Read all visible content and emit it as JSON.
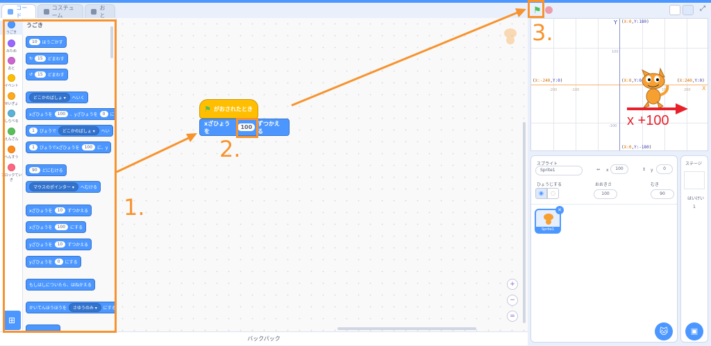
{
  "tabs": [
    {
      "label": "コード"
    },
    {
      "label": "コスチューム"
    },
    {
      "label": "おと"
    }
  ],
  "categories": [
    {
      "label": "うごき",
      "color": "#4c97ff"
    },
    {
      "label": "みため",
      "color": "#9966ff"
    },
    {
      "label": "おと",
      "color": "#cf63cf"
    },
    {
      "label": "イベント",
      "color": "#ffbf00"
    },
    {
      "label": "せいぎょ",
      "color": "#ffab19"
    },
    {
      "label": "しらべる",
      "color": "#5cb1d6"
    },
    {
      "label": "えんざん",
      "color": "#59c059"
    },
    {
      "label": "へんすう",
      "color": "#ff8c1a"
    },
    {
      "label": "ブロックてい",
      "color": "#ff6680"
    }
  ],
  "categories_extra": "ぎ",
  "palette": {
    "title": "うごき",
    "b1": {
      "val": "10",
      "text": "ほうごかす"
    },
    "b2": {
      "val": "15",
      "text": "どまわす"
    },
    "b3": {
      "val": "15",
      "text": "どまわす"
    },
    "b4": {
      "dd": "どこかのばしょ ▾",
      "text": "へいく"
    },
    "b5": {
      "t1": "xざひょうを",
      "v1": "100",
      "t2": "、yざひょうを",
      "v2": "0",
      "t3": "にす"
    },
    "b6": {
      "v": "1",
      "t1": "びょうで",
      "dd": "どこかのばしょ ▾",
      "t2": "へい"
    },
    "b7": {
      "v": "1",
      "t1": "びょうでxざひょうを",
      "v2": "100",
      "t2": "に、y"
    },
    "b8": {
      "v": "90",
      "t": "どにむける"
    },
    "b9": {
      "dd": "マウスのポインター ▾",
      "t": "へむける"
    },
    "b10": {
      "t1": "xざひょうを",
      "v": "10",
      "t2": "ずつかえる"
    },
    "b11": {
      "t1": "xざひょうを",
      "v": "100",
      "t2": "にする"
    },
    "b12": {
      "t1": "yざひょうを",
      "v": "10",
      "t2": "ずつかえる"
    },
    "b13": {
      "t1": "yざひょうを",
      "v": "0",
      "t2": "にする"
    },
    "b14": {
      "t": "もしはしについたら、はねかえる"
    },
    "b15": {
      "t1": "かいてんほうほうを",
      "dd": "さゆうのみ ▾",
      "t2": "にする"
    }
  },
  "script": {
    "hat": "がおされたとき",
    "motion_pre": "xざひょうを",
    "motion_val": "100",
    "motion_post": "ずつかえる"
  },
  "zoom": {
    "in": "+",
    "out": "−",
    "reset": "="
  },
  "backpack": "バックパック",
  "stage": {
    "y_axis": "Y",
    "x_axis": "X",
    "c_top": {
      "pre": "(",
      "x": "X:0",
      "comma": ",",
      "y": "Y:180",
      "post": ")"
    },
    "c_left": {
      "pre": "(",
      "x": "X:-240",
      "comma": ",",
      "y": "Y:0",
      "post": ")"
    },
    "c_center": {
      "pre": "(",
      "x": "X:0",
      "comma": ",",
      "y": "Y:0",
      "post": ")"
    },
    "c_right": {
      "pre": "(",
      "x": "X:240",
      "comma": ",",
      "y": "Y:0",
      "post": ")"
    },
    "c_bottom": {
      "pre": "(",
      "x": "X:0",
      "comma": ",",
      "y": "Y:-180",
      "post": ")"
    },
    "t1": "-200",
    "t2": "-100",
    "t3": "100",
    "t4": "200",
    "ty1": "100",
    "ty2": "-100",
    "annotation": "x +100"
  },
  "sprite_info": {
    "title": "スプライト",
    "name": "Sprite1",
    "x_label": "x",
    "x": "100",
    "y_label": "y",
    "y": "0",
    "show_label": "ひょうじする",
    "size_label": "おおきさ",
    "size": "100",
    "dir_label": "むき",
    "dir": "90",
    "thumb_label": "Sprite1"
  },
  "stage_panel": {
    "title": "ステージ",
    "backdrop_label": "はいけい",
    "backdrop_count": "1"
  },
  "annotations": {
    "n1": "1.",
    "n2": "2.",
    "n3": "3."
  },
  "colors": {
    "accent": "#4c97ff",
    "annotation": "#f7932e",
    "arrow_red": "#e8202a",
    "event": "#ffbf00"
  }
}
